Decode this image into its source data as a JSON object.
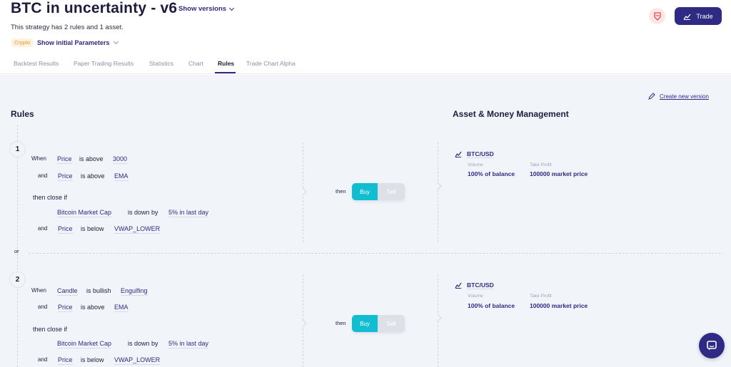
{
  "header": {
    "title": "BTC in uncertainty - v6",
    "show_versions": "Show versions",
    "subtitle": "This strategy has 2 rules and 1 asset.",
    "tag": "Crypto",
    "initial_params": "Show initial Parameters",
    "trade_label": "Trade"
  },
  "tabs": [
    {
      "label": "Backtest Results"
    },
    {
      "label": "Paper Trading Results"
    },
    {
      "label": "Statistics"
    },
    {
      "label": "Chart"
    },
    {
      "label": "Rules",
      "active": true
    },
    {
      "label": "Trade Chart Alpha"
    }
  ],
  "content": {
    "create_version": "Create new version",
    "rules_title": "Rules",
    "asset_title": "Asset & Money Management",
    "or_label": "or"
  },
  "rules": [
    {
      "number": "1",
      "conditions": [
        {
          "kw": "When",
          "subject": "Price",
          "op": "is above",
          "value": "3000"
        },
        {
          "kw": "and",
          "subject": "Price",
          "op": "is above",
          "value": "EMA"
        }
      ],
      "close_label": "then close if",
      "close_conditions": [
        {
          "kw": "",
          "subject": "Bitcoin Market Cap",
          "op": "is down by",
          "value": "5% in last day"
        },
        {
          "kw": "and",
          "subject": "Price",
          "op": "is below",
          "value": "VWAP_LOWER"
        }
      ],
      "then_label": "then",
      "buy": "Buy",
      "sell": "Sell",
      "asset": {
        "pair": "BTC/USD",
        "volume_label": "Volume",
        "volume": "100% of balance",
        "tp_label": "Take Profit",
        "tp": "100000 market price"
      }
    },
    {
      "number": "2",
      "conditions": [
        {
          "kw": "When",
          "subject": "Candle",
          "op": "is bullish",
          "value": "Engulfing"
        },
        {
          "kw": "and",
          "subject": "Price",
          "op": "is above",
          "value": "EMA"
        }
      ],
      "close_label": "then close if",
      "close_conditions": [
        {
          "kw": "",
          "subject": "Bitcoin Market Cap",
          "op": "is down by",
          "value": "5% in last day"
        },
        {
          "kw": "and",
          "subject": "Price",
          "op": "is below",
          "value": "VWAP_LOWER"
        }
      ],
      "then_label": "then",
      "buy": "Buy",
      "sell": "Sell",
      "asset": {
        "pair": "BTC/USD",
        "volume_label": "Volume",
        "volume": "100% of balance",
        "tp_label": "Take Profit",
        "tp": "100000 market price"
      }
    }
  ],
  "colors": {
    "brand": "#2f2a83",
    "buy": "#11bdd0",
    "tag": "#e79a2e"
  },
  "icons": [
    "chevron-down-icon",
    "shield-icon",
    "chart-icon",
    "pencil-icon",
    "chat-icon"
  ]
}
